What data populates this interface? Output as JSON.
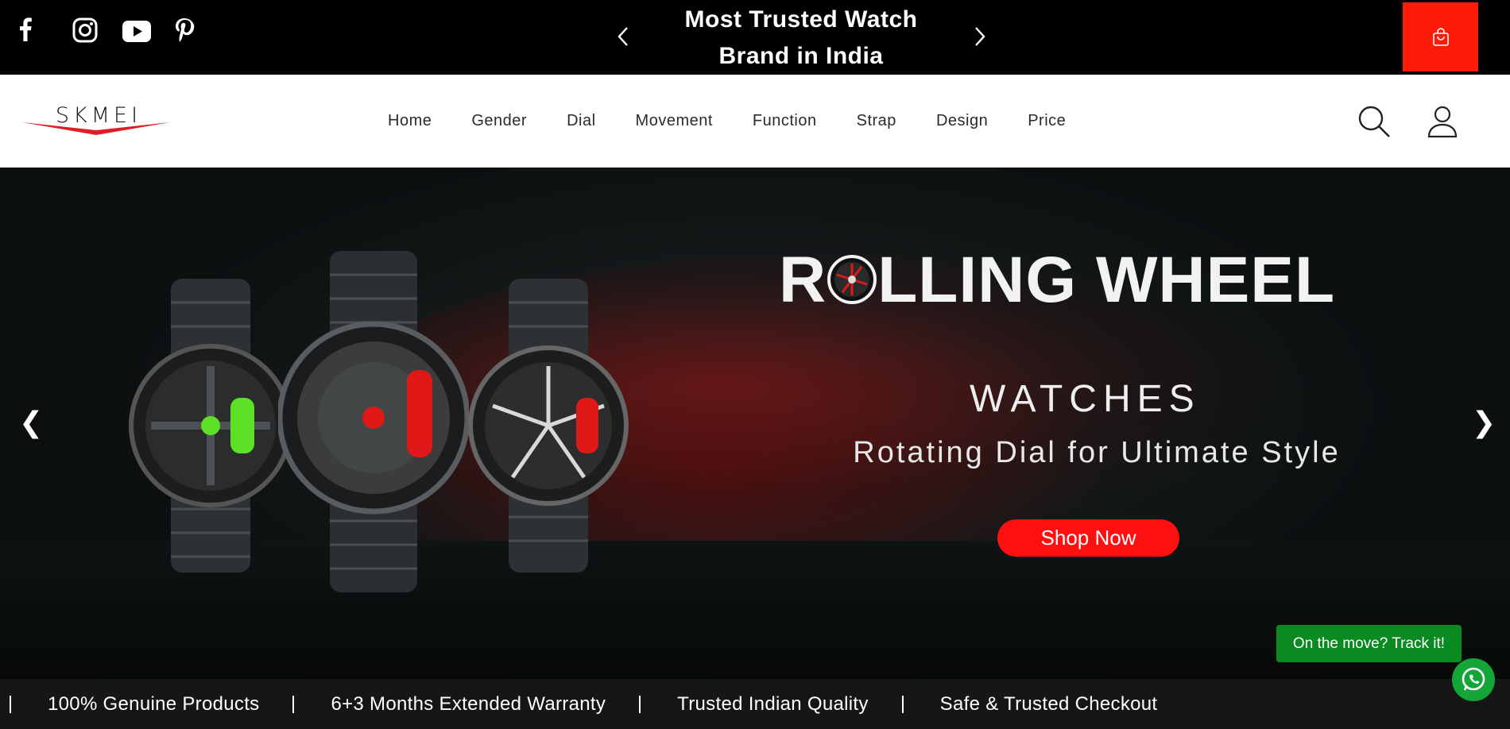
{
  "topbar": {
    "social": [
      {
        "name": "facebook-icon"
      },
      {
        "name": "instagram-icon"
      },
      {
        "name": "youtube-icon"
      },
      {
        "name": "pinterest-icon"
      }
    ],
    "announcement": "Most Trusted Watch Brand in India",
    "cart_color": "#ff1b0a"
  },
  "header": {
    "logo_text": "SKMEI",
    "nav": [
      "Home",
      "Gender",
      "Dial",
      "Movement",
      "Function",
      "Strap",
      "Design",
      "Price"
    ]
  },
  "hero": {
    "title_prefix": "R",
    "title_suffix": "LLING WHEEL",
    "subtitle": "WATCHES",
    "tagline": "Rotating Dial for Ultimate Style",
    "cta": "Shop Now",
    "prev_arrow": "❮",
    "next_arrow": "❯",
    "accent": "#ff0f0f"
  },
  "floating": {
    "track_label": "On the move? Track it!",
    "track_color": "#0a8a21",
    "whatsapp_color": "#13a538"
  },
  "trust": {
    "items": [
      "100% Genuine Products",
      "6+3 Months Extended Warranty",
      "Trusted Indian Quality",
      "Safe & Trusted Checkout"
    ]
  }
}
